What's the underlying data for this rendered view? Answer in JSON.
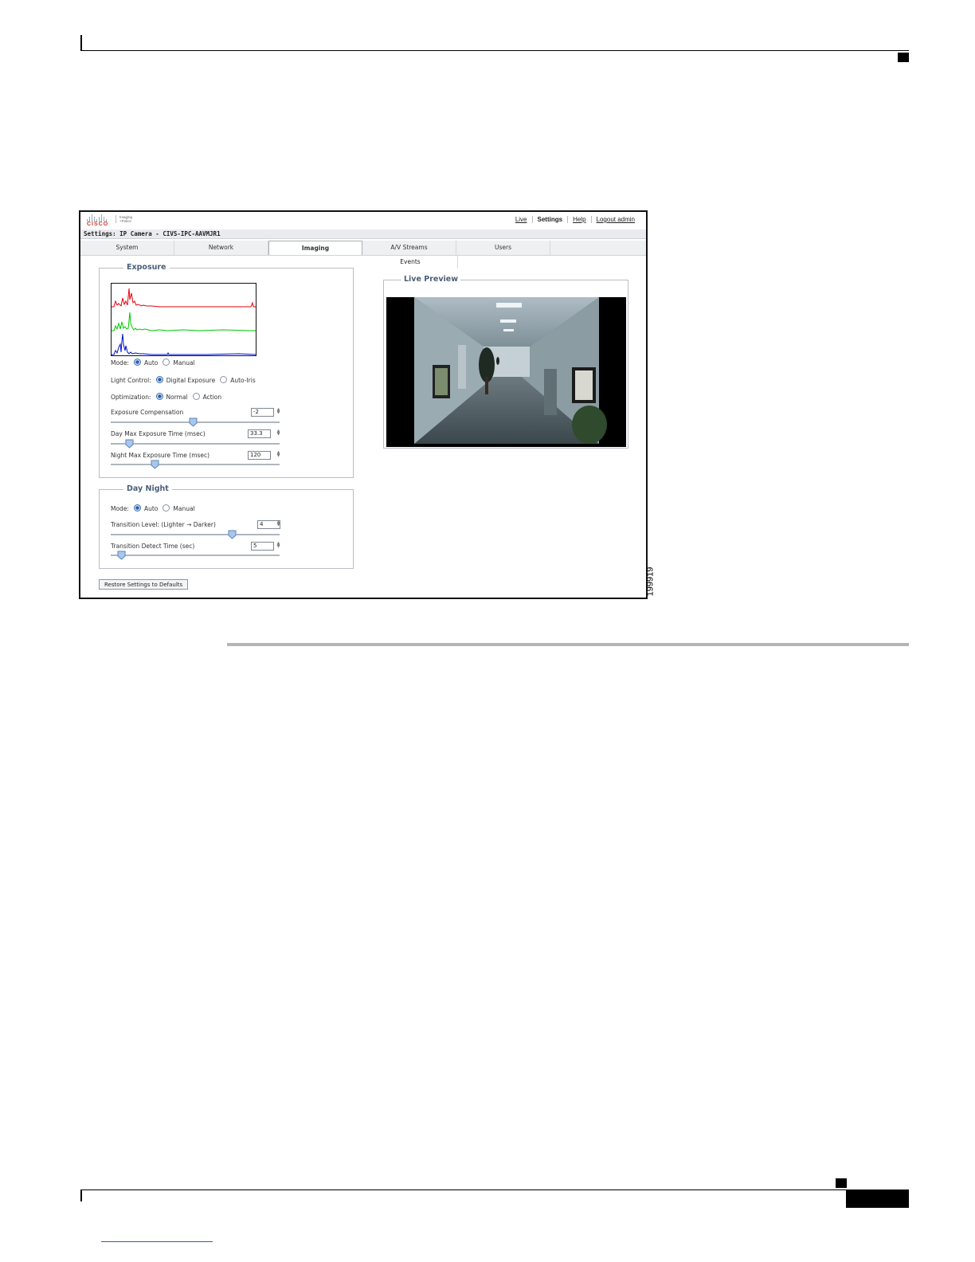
{
  "figure_number": "199919",
  "topbar": {
    "logo_text": "CISCO",
    "logo_sub": [
      "Imaging",
      "+Police"
    ],
    "links": [
      {
        "label": "Live",
        "active": false
      },
      {
        "label": "Settings",
        "active": true
      },
      {
        "label": "Help",
        "active": false
      },
      {
        "label": "Logout admin",
        "active": false
      }
    ]
  },
  "title": "Settings: IP Camera - CIVS-IPC-AAVMJR1",
  "tabs": [
    "System",
    "Network",
    "Imaging",
    "A/V Streams",
    "Users"
  ],
  "active_tab": "Imaging",
  "subtab": "Events",
  "exposure": {
    "legend": "Exposure",
    "mode_label": "Mode:",
    "mode_options": [
      "Auto",
      "Manual"
    ],
    "mode_selected": "Auto",
    "light_control_label": "Light Control:",
    "light_control_options": [
      "Digital Exposure",
      "Auto-Iris"
    ],
    "light_control_selected": "Digital Exposure",
    "optimization_label": "Optimization:",
    "optimization_options": [
      "Normal",
      "Action"
    ],
    "optimization_selected": "Normal",
    "compensation_label": "Exposure Compensation",
    "compensation_value": "-2",
    "compensation_slider_fraction": 0.49,
    "day_max_label": "Day Max Exposure Time (msec)",
    "day_max_value": "33.3",
    "day_max_slider_fraction": 0.09,
    "night_max_label": "Night Max Exposure Time (msec)",
    "night_max_value": "120",
    "night_max_slider_fraction": 0.25
  },
  "day_night": {
    "legend": "Day Night",
    "mode_label": "Mode:",
    "mode_options": [
      "Auto",
      "Manual"
    ],
    "mode_selected": "Auto",
    "transition_level_label": "Transition Level: (Lighter → Darker)",
    "transition_level_value": "4",
    "transition_level_slider_fraction": 0.73,
    "transition_time_label": "Transition Detect Time (sec)",
    "transition_time_value": "5",
    "transition_time_slider_fraction": 0.04
  },
  "live_preview": {
    "legend": "Live Preview"
  },
  "restore_button": "Restore Settings to Defaults",
  "colors": {
    "histogram_red": "#e8000b",
    "histogram_green": "#00c800",
    "histogram_blue": "#0010c8",
    "legend_text": "#4a5f78",
    "logo_red": "#c0392b"
  },
  "icons": [
    "cisco-logo-icon",
    "radio-selected-icon",
    "radio-unselected-icon",
    "spinner-icon",
    "slider-thumb-icon"
  ]
}
